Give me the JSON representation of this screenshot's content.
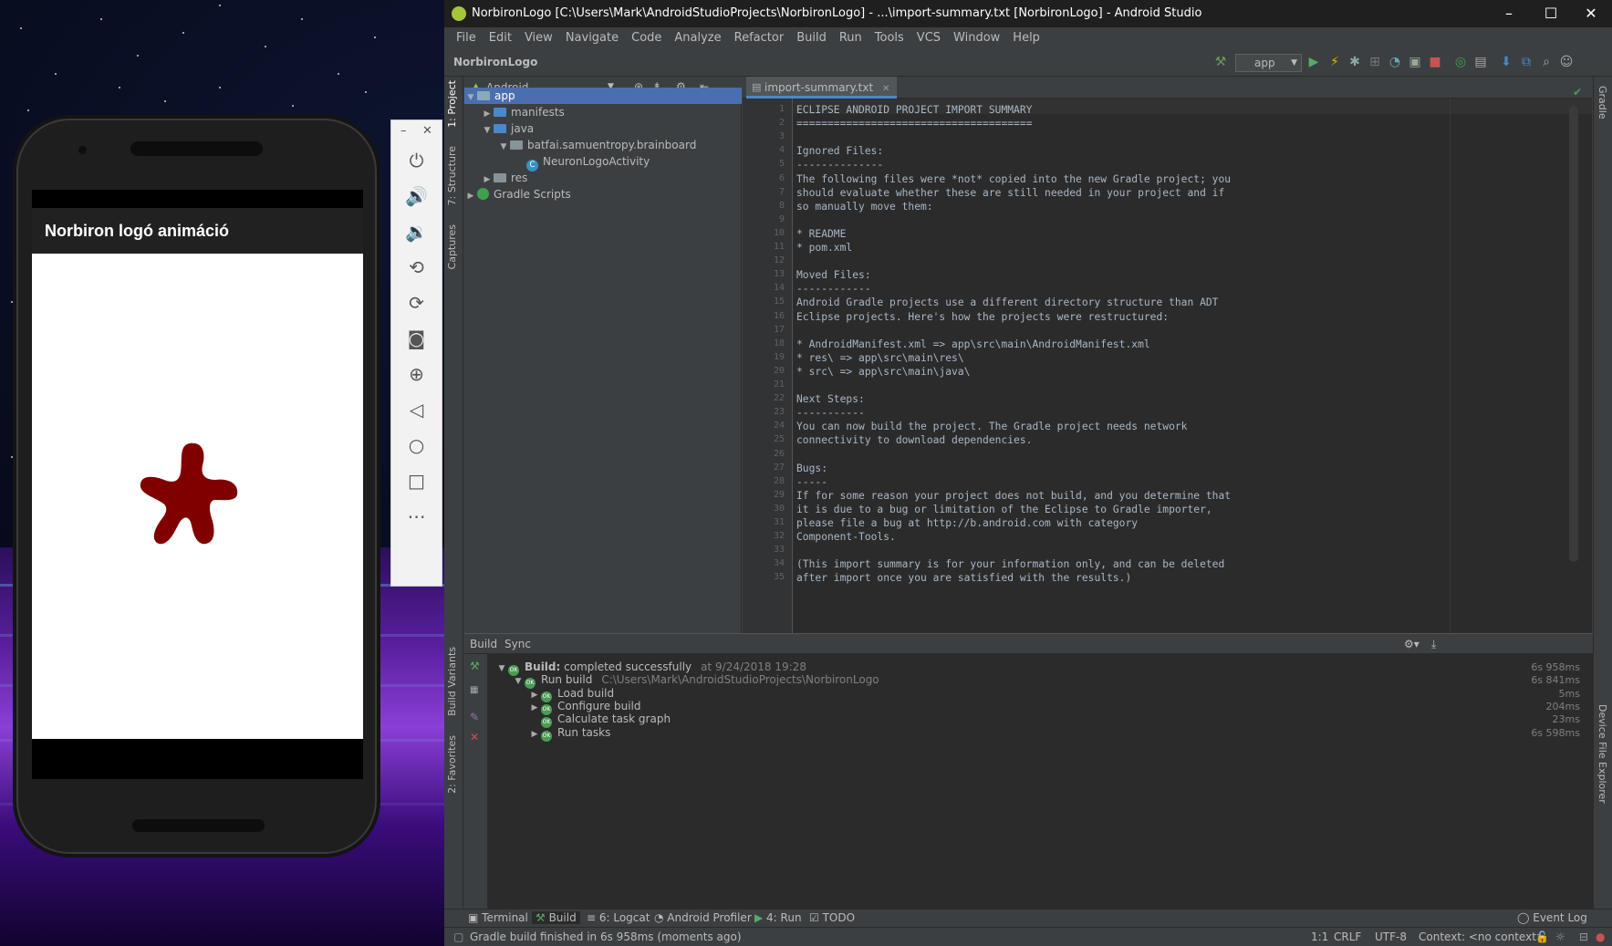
{
  "android_studio": {
    "title": "NorbironLogo [C:\\Users\\Mark\\AndroidStudioProjects\\NorbironLogo] - ...\\import-summary.txt [NorbironLogo] - Android Studio",
    "menu": [
      "File",
      "Edit",
      "View",
      "Navigate",
      "Code",
      "Analyze",
      "Refactor",
      "Build",
      "Run",
      "Tools",
      "VCS",
      "Window",
      "Help"
    ],
    "breadcrumb": "NorbironLogo",
    "run_config": "app",
    "left_tabs": {
      "project": "1: Project",
      "structure": "7: Structure",
      "captures": "Captures",
      "build_variants": "Build Variants",
      "favorites": "2: Favorites"
    },
    "right_tabs": {
      "gradle": "Gradle",
      "device_explorer": "Device File Explorer"
    },
    "project_panel": {
      "view": "Android",
      "tree": [
        {
          "label": "app",
          "level": 0
        },
        {
          "label": "manifests",
          "level": 1
        },
        {
          "label": "java",
          "level": 1
        },
        {
          "label": "batfai.samuentropy.brainboard",
          "level": 2
        },
        {
          "label": "NeuronLogoActivity",
          "level": 3
        },
        {
          "label": "res",
          "level": 1
        },
        {
          "label": "Gradle Scripts",
          "level": 0
        }
      ]
    },
    "editor": {
      "tab": "import-summary.txt",
      "lines": [
        "ECLIPSE ANDROID PROJECT IMPORT SUMMARY",
        "======================================",
        "",
        "Ignored Files:",
        "--------------",
        "The following files were *not* copied into the new Gradle project; you",
        "should evaluate whether these are still needed in your project and if",
        "so manually move them:",
        "",
        "* README",
        "* pom.xml",
        "",
        "Moved Files:",
        "------------",
        "Android Gradle projects use a different directory structure than ADT",
        "Eclipse projects. Here's how the projects were restructured:",
        "",
        "* AndroidManifest.xml => app\\src\\main\\AndroidManifest.xml",
        "* res\\ => app\\src\\main\\res\\",
        "* src\\ => app\\src\\main\\java\\",
        "",
        "Next Steps:",
        "-----------",
        "You can now build the project. The Gradle project needs network",
        "connectivity to download dependencies.",
        "",
        "Bugs:",
        "-----",
        "If for some reason your project does not build, and you determine that",
        "it is due to a bug or limitation of the Eclipse to Gradle importer,",
        "please file a bug at http://b.android.com with category",
        "Component-Tools.",
        "",
        "(This import summary is for your information only, and can be deleted",
        "after import once you are satisfied with the results.)"
      ]
    },
    "build_panel": {
      "tabs": [
        "Build",
        "Sync"
      ],
      "rows": [
        {
          "label": "Build:",
          "rest": " completed successfully",
          "extra": "at 9/24/2018 19:28",
          "time": "6s 958ms",
          "level": 0
        },
        {
          "label": "Run build",
          "rest": "",
          "extra": "C:\\Users\\Mark\\AndroidStudioProjects\\NorbironLogo",
          "time": "6s 841ms",
          "level": 1
        },
        {
          "label": "Load build",
          "rest": "",
          "extra": "",
          "time": "5ms",
          "level": 2
        },
        {
          "label": "Configure build",
          "rest": "",
          "extra": "",
          "time": "204ms",
          "level": 2
        },
        {
          "label": "Calculate task graph",
          "rest": "",
          "extra": "",
          "time": "23ms",
          "level": 2
        },
        {
          "label": "Run tasks",
          "rest": "",
          "extra": "",
          "time": "6s 598ms",
          "level": 2
        }
      ]
    },
    "bottom_tools": [
      "Terminal",
      "Build",
      "6: Logcat",
      "Android Profiler",
      "4: Run",
      "TODO",
      "Event Log"
    ],
    "status": {
      "message": "Gradle build finished in 6s 958ms (moments ago)",
      "position": "1:1",
      "line_sep": "CRLF",
      "encoding": "UTF-8",
      "context": "Context: <no context>"
    }
  },
  "emulator": {
    "app_title": "Norbiron logó animáció",
    "logo_color": "#800000"
  },
  "colors": {
    "accent": "#4a88c7",
    "success": "#499c54"
  }
}
